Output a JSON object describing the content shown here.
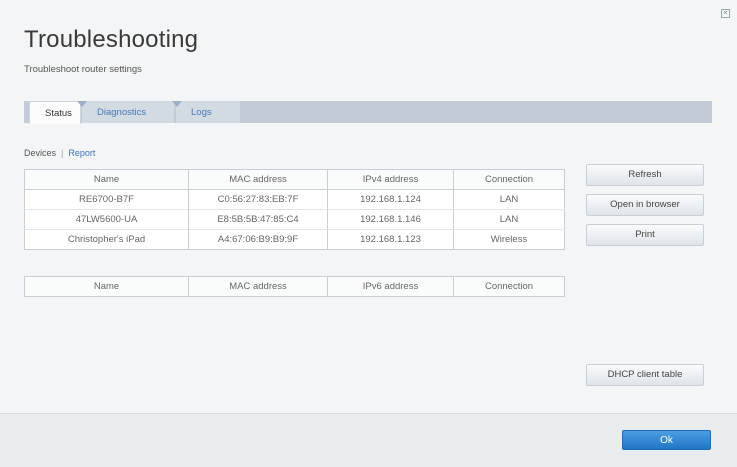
{
  "dialog": {
    "title": "Troubleshooting",
    "subtitle": "Troubleshoot router settings",
    "close_symbol": "×"
  },
  "tabs": [
    {
      "label": "Status",
      "active": true
    },
    {
      "label": "Diagnostics",
      "active": false
    },
    {
      "label": "Logs",
      "active": false
    }
  ],
  "subnav": {
    "devices": "Devices",
    "separator": "|",
    "report": "Report"
  },
  "ipv4_table": {
    "headers": [
      "Name",
      "MAC address",
      "IPv4 address",
      "Connection"
    ],
    "rows": [
      [
        "RE6700-B7F",
        "C0:56:27:83:EB:7F",
        "192.168.1.124",
        "LAN"
      ],
      [
        "47LW5600-UA",
        "E8:5B:5B:47:85:C4",
        "192.168.1.146",
        "LAN"
      ],
      [
        "Christopher's iPad",
        "A4:67:06:B9:B9:9F",
        "192.168.1.123",
        "Wireless"
      ]
    ]
  },
  "ipv6_table": {
    "headers": [
      "Name",
      "MAC address",
      "IPv6 address",
      "Connection"
    ]
  },
  "buttons": {
    "refresh": "Refresh",
    "open_in_browser": "Open in browser",
    "print": "Print",
    "dhcp_client_table": "DHCP client table",
    "ok": "Ok"
  },
  "colors": {
    "accent": "#2a83d4",
    "link": "#3d74b8"
  }
}
